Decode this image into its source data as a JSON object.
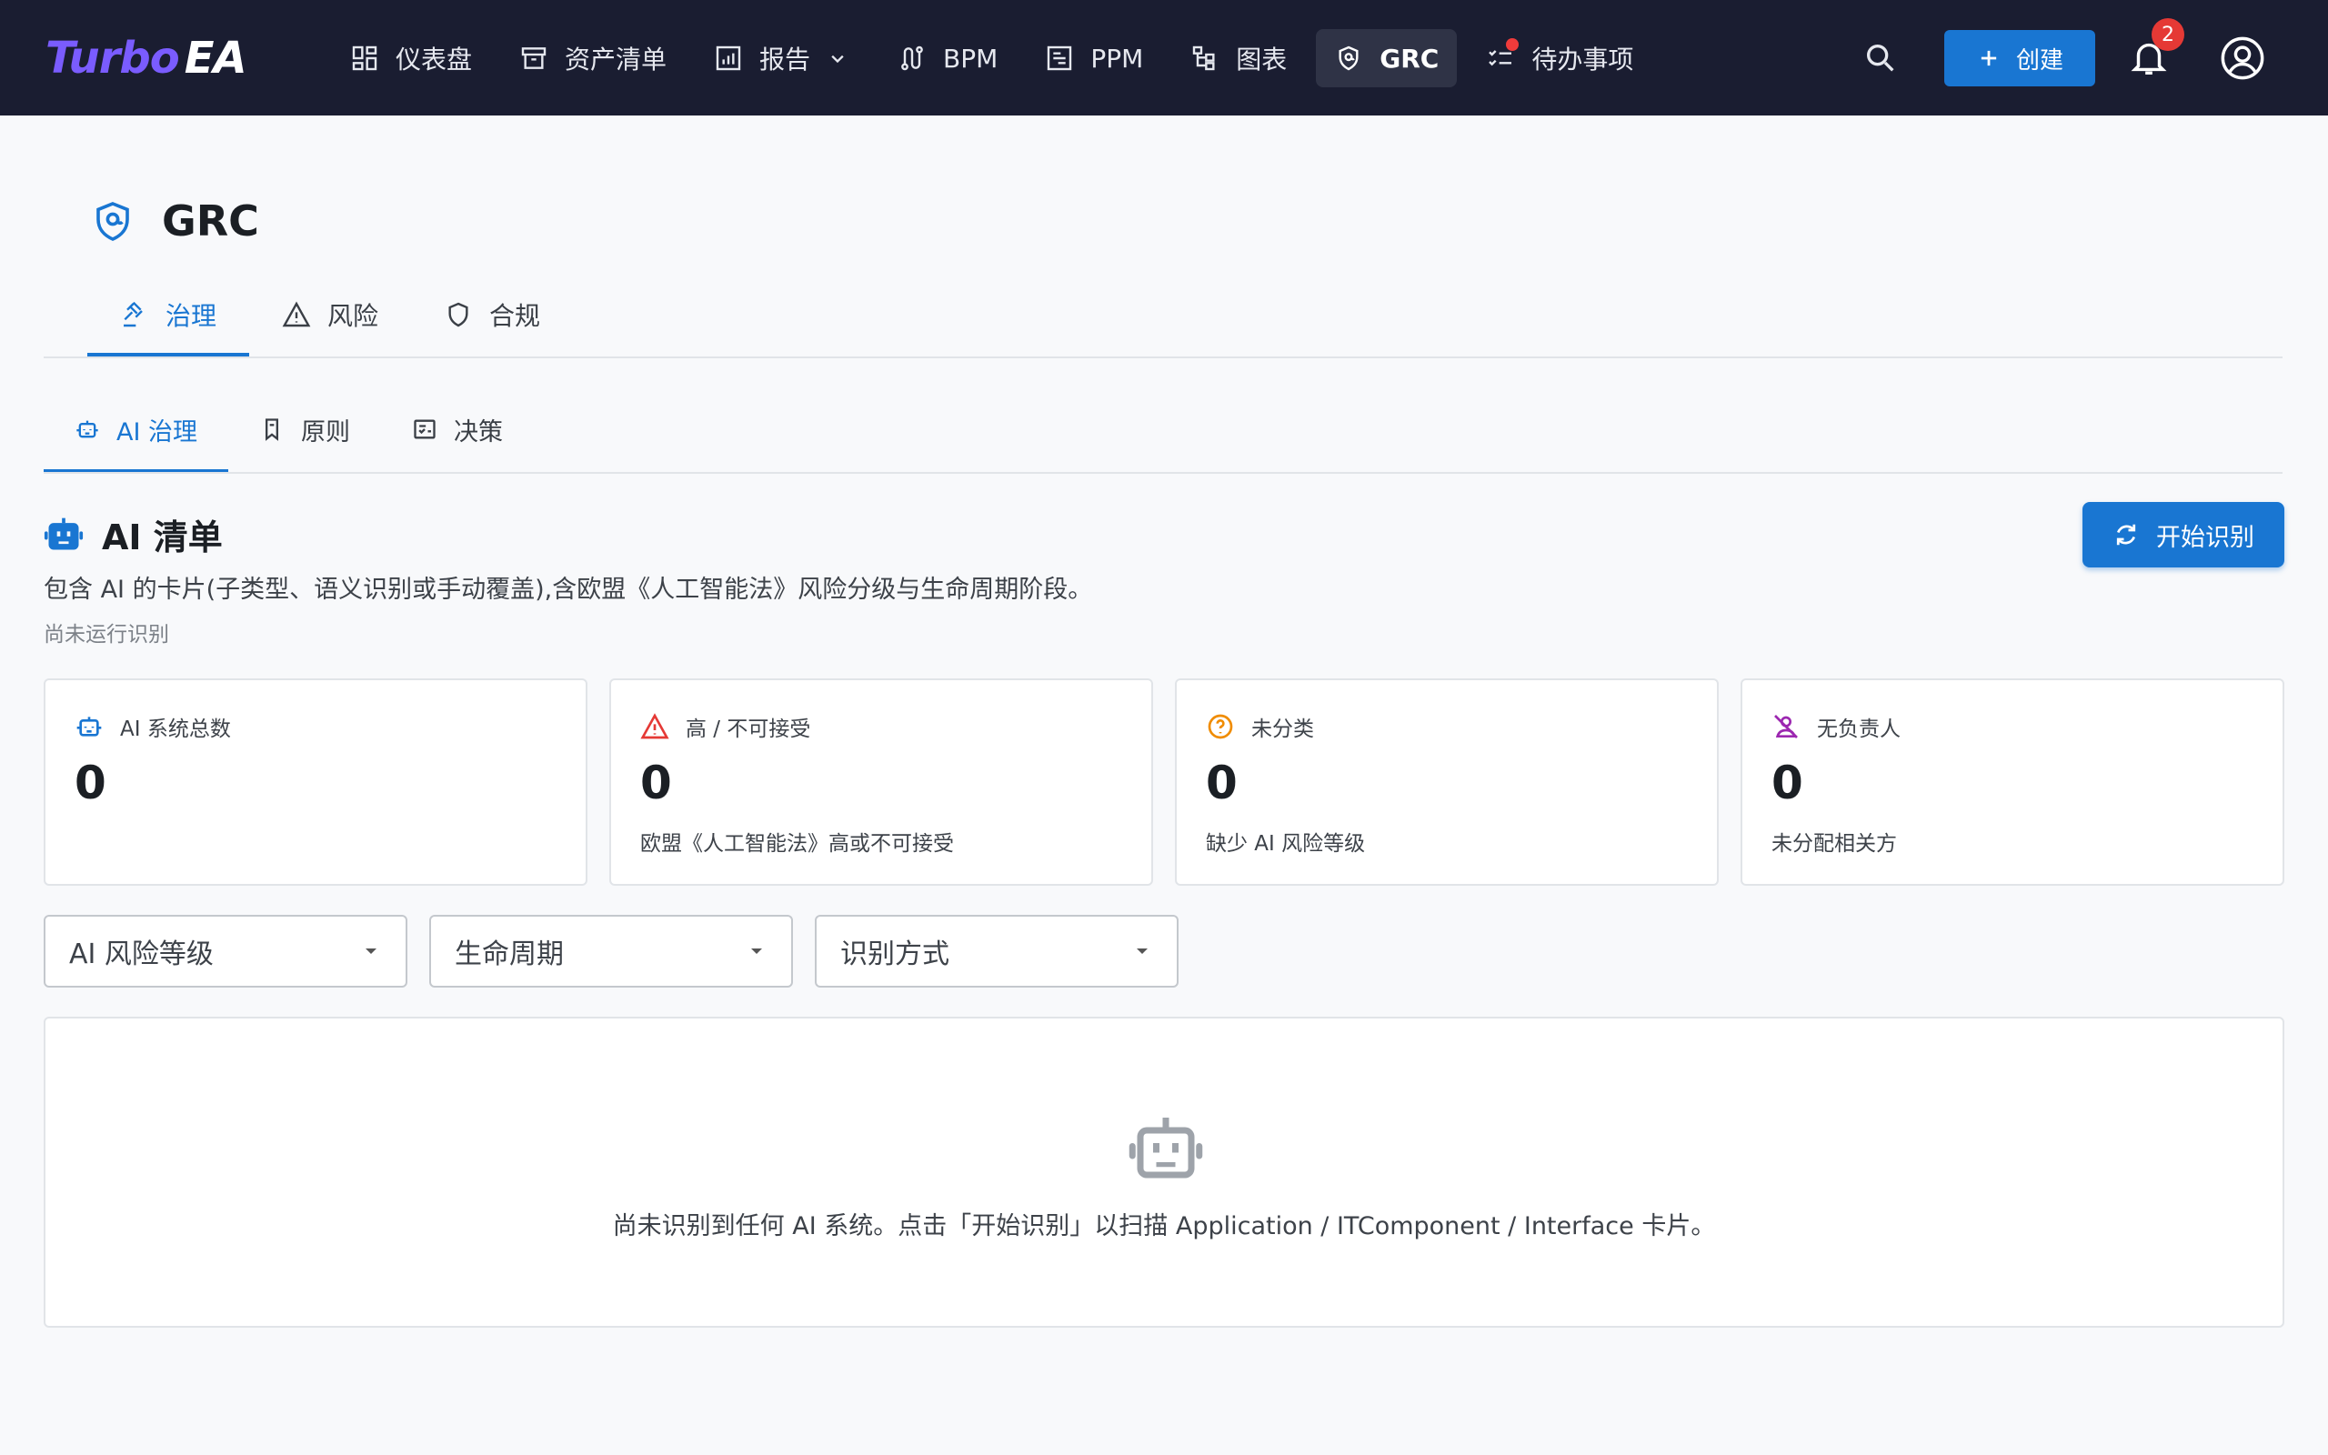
{
  "brand": {
    "part1": "Turbo",
    "part2": "EA"
  },
  "nav": {
    "items": [
      {
        "label": "仪表盘"
      },
      {
        "label": "资产清单"
      },
      {
        "label": "报告"
      },
      {
        "label": "BPM"
      },
      {
        "label": "PPM"
      },
      {
        "label": "图表"
      },
      {
        "label": "GRC"
      },
      {
        "label": "待办事项"
      }
    ],
    "active": "GRC"
  },
  "toolbar": {
    "create_label": "创建",
    "notifications_count": "2"
  },
  "page": {
    "title": "GRC"
  },
  "tabs_primary": [
    {
      "label": "治理"
    },
    {
      "label": "风险"
    },
    {
      "label": "合规"
    }
  ],
  "tabs_secondary": [
    {
      "label": "AI 治理"
    },
    {
      "label": "原则"
    },
    {
      "label": "决策"
    }
  ],
  "section": {
    "title": "AI 清单",
    "description": "包含 AI 的卡片(子类型、语义识别或手动覆盖),含欧盟《人工智能法》风险分级与生命周期阶段。",
    "note": "尚未运行识别",
    "scan_button": "开始识别"
  },
  "stats": [
    {
      "label": "AI 系统总数",
      "value": "0",
      "sub": ""
    },
    {
      "label": "高 / 不可接受",
      "value": "0",
      "sub": "欧盟《人工智能法》高或不可接受"
    },
    {
      "label": "未分类",
      "value": "0",
      "sub": "缺少 AI 风险等级"
    },
    {
      "label": "无负责人",
      "value": "0",
      "sub": "未分配相关方"
    }
  ],
  "filters": [
    {
      "placeholder": "AI 风险等级"
    },
    {
      "placeholder": "生命周期"
    },
    {
      "placeholder": "识别方式"
    }
  ],
  "empty_state": {
    "message": "尚未识别到任何 AI 系统。点击「开始识别」以扫描 Application / ITComponent / Interface 卡片。"
  },
  "colors": {
    "nav_bg": "#1a1d31",
    "accent": "#1976d2",
    "danger": "#e53935",
    "warning": "#f08c00",
    "purple": "#9c27b0"
  }
}
